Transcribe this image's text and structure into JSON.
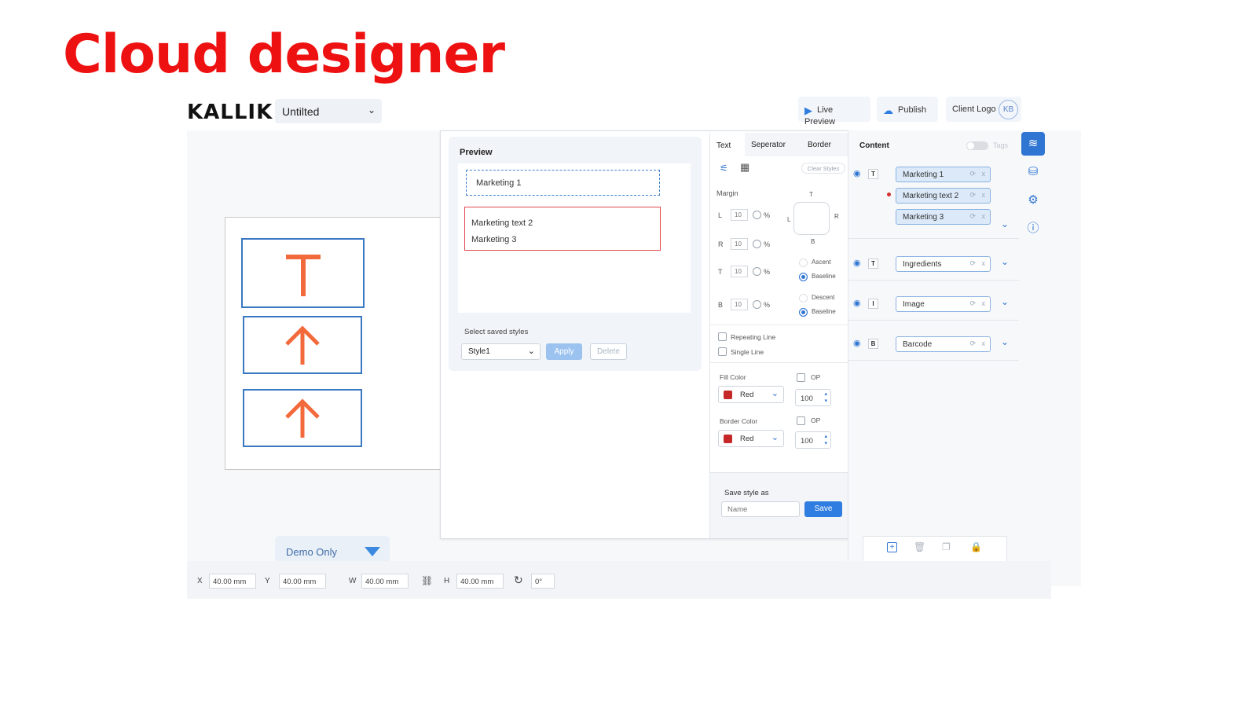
{
  "slide": {
    "title": "Cloud designer"
  },
  "header": {
    "logo": "KALLIK",
    "doc_name": "Untilted",
    "live_preview": "Live Preview",
    "publish": "Publish",
    "client_logo": "Client Logo",
    "avatar": "KB"
  },
  "canvas": {
    "demo_label": "Demo Only",
    "tiles": [
      {
        "icon": "text-icon",
        "glyph": "T"
      },
      {
        "icon": "arrow-up-icon"
      },
      {
        "icon": "arrow-up-icon"
      }
    ]
  },
  "preview": {
    "title": "Preview",
    "item1": "Marketing 1",
    "item2": "Marketing text 2",
    "item3": "Marketing 3",
    "saved_styles_label": "Select saved styles",
    "style_value": "Style1",
    "apply": "Apply",
    "delete": "Delete"
  },
  "properties": {
    "tabs": [
      "Text",
      "Seperator",
      "Border"
    ],
    "clear_styles": "Clear Styles",
    "margin_label": "Margin",
    "margins": [
      {
        "side": "L",
        "value": "10",
        "unit": "%"
      },
      {
        "side": "R",
        "value": "10",
        "unit": "%"
      },
      {
        "side": "T",
        "value": "10",
        "unit": "%"
      },
      {
        "side": "B",
        "value": "10",
        "unit": "%"
      }
    ],
    "box_labels": {
      "top": "T",
      "left": "L",
      "right": "R",
      "bottom": "B"
    },
    "ascent": "Ascent",
    "baseline": "Baseline",
    "descent": "Descent",
    "repeating_line": "Repeating Line",
    "single_line": "Single Line",
    "fill_color_label": "Fill Color",
    "fill_color": "Red",
    "fill_op": "OP",
    "fill_opacity": "100",
    "border_color_label": "Border Color",
    "border_color": "Red",
    "border_op": "OP",
    "border_opacity": "100",
    "save_style_label": "Save style as",
    "name_placeholder": "Name",
    "save": "Save"
  },
  "content": {
    "title": "Content",
    "tags_label": "Tags",
    "group1": [
      "Marketing 1",
      "Marketing text 2",
      "Marketing 3"
    ],
    "rows": [
      {
        "badge": "T",
        "label": "Ingredients"
      },
      {
        "badge": "I",
        "label": "Image"
      },
      {
        "badge": "B",
        "label": "Barcode"
      }
    ],
    "chip_close": "x"
  },
  "status": {
    "x_label": "X",
    "x_value": "40.00 mm",
    "y_label": "Y",
    "y_value": "40.00 mm",
    "w_label": "W",
    "w_value": "40.00 mm",
    "h_label": "H",
    "h_value": "40.00 mm",
    "rotation": "0°"
  },
  "colors": {
    "accent": "#2f76d2",
    "title_red": "#ee1111",
    "tile_orange": "#f26a3b"
  }
}
